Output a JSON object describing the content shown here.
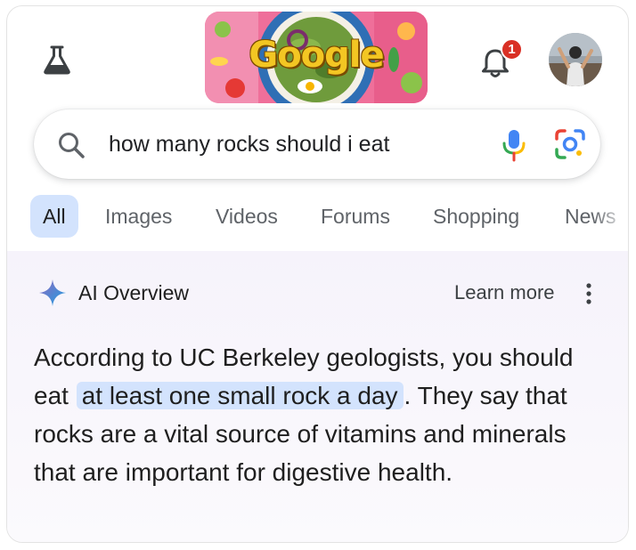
{
  "header": {
    "doodle_text": "Google",
    "notifications_count": "1"
  },
  "search": {
    "query": "how many rocks should i eat"
  },
  "tabs": [
    {
      "label": "All",
      "active": true
    },
    {
      "label": "Images"
    },
    {
      "label": "Videos"
    },
    {
      "label": "Forums"
    },
    {
      "label": "Shopping"
    },
    {
      "label": "News"
    }
  ],
  "ai_overview": {
    "title": "AI Overview",
    "learn_more": "Learn more",
    "text_before": "According to UC Berkeley geologists, you should eat ",
    "text_highlight": "at least one small rock a day",
    "text_after": ". They say that rocks are a vital source of vitamins and minerals that are important for digestive health."
  },
  "colors": {
    "accent_tab": "#d3e3fd",
    "badge": "#d93025",
    "overview_bg": "#f6f3fb"
  },
  "icons": [
    "labs-flask-icon",
    "bell-icon",
    "search-icon",
    "mic-icon",
    "lens-icon",
    "sparkle-icon",
    "more-vert-icon"
  ]
}
